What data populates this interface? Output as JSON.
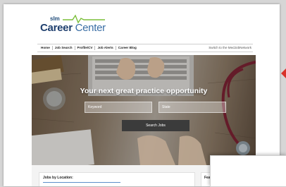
{
  "site": {
    "logo_small": "slm",
    "logo_main_bold": "Career",
    "logo_main_light": "Center"
  },
  "nav": {
    "items": [
      "Home",
      "Job Search",
      "Profile/CV",
      "Job Alerts",
      "Career Blog"
    ],
    "right_link": "Switch to the MedJobNetwork"
  },
  "hero": {
    "title": "Your next great practice opportunity",
    "keyword_placeholder": "Keyword",
    "state_placeholder": "State",
    "search_button": "Search Jobs"
  },
  "sections": {
    "jobs_by_location": "Jobs by Location:",
    "featured_partial": "Fea"
  },
  "colors": {
    "brand_blue": "#1f3f6e",
    "accent_green": "#7bbf3a",
    "side_arrow": "#d8322a"
  }
}
